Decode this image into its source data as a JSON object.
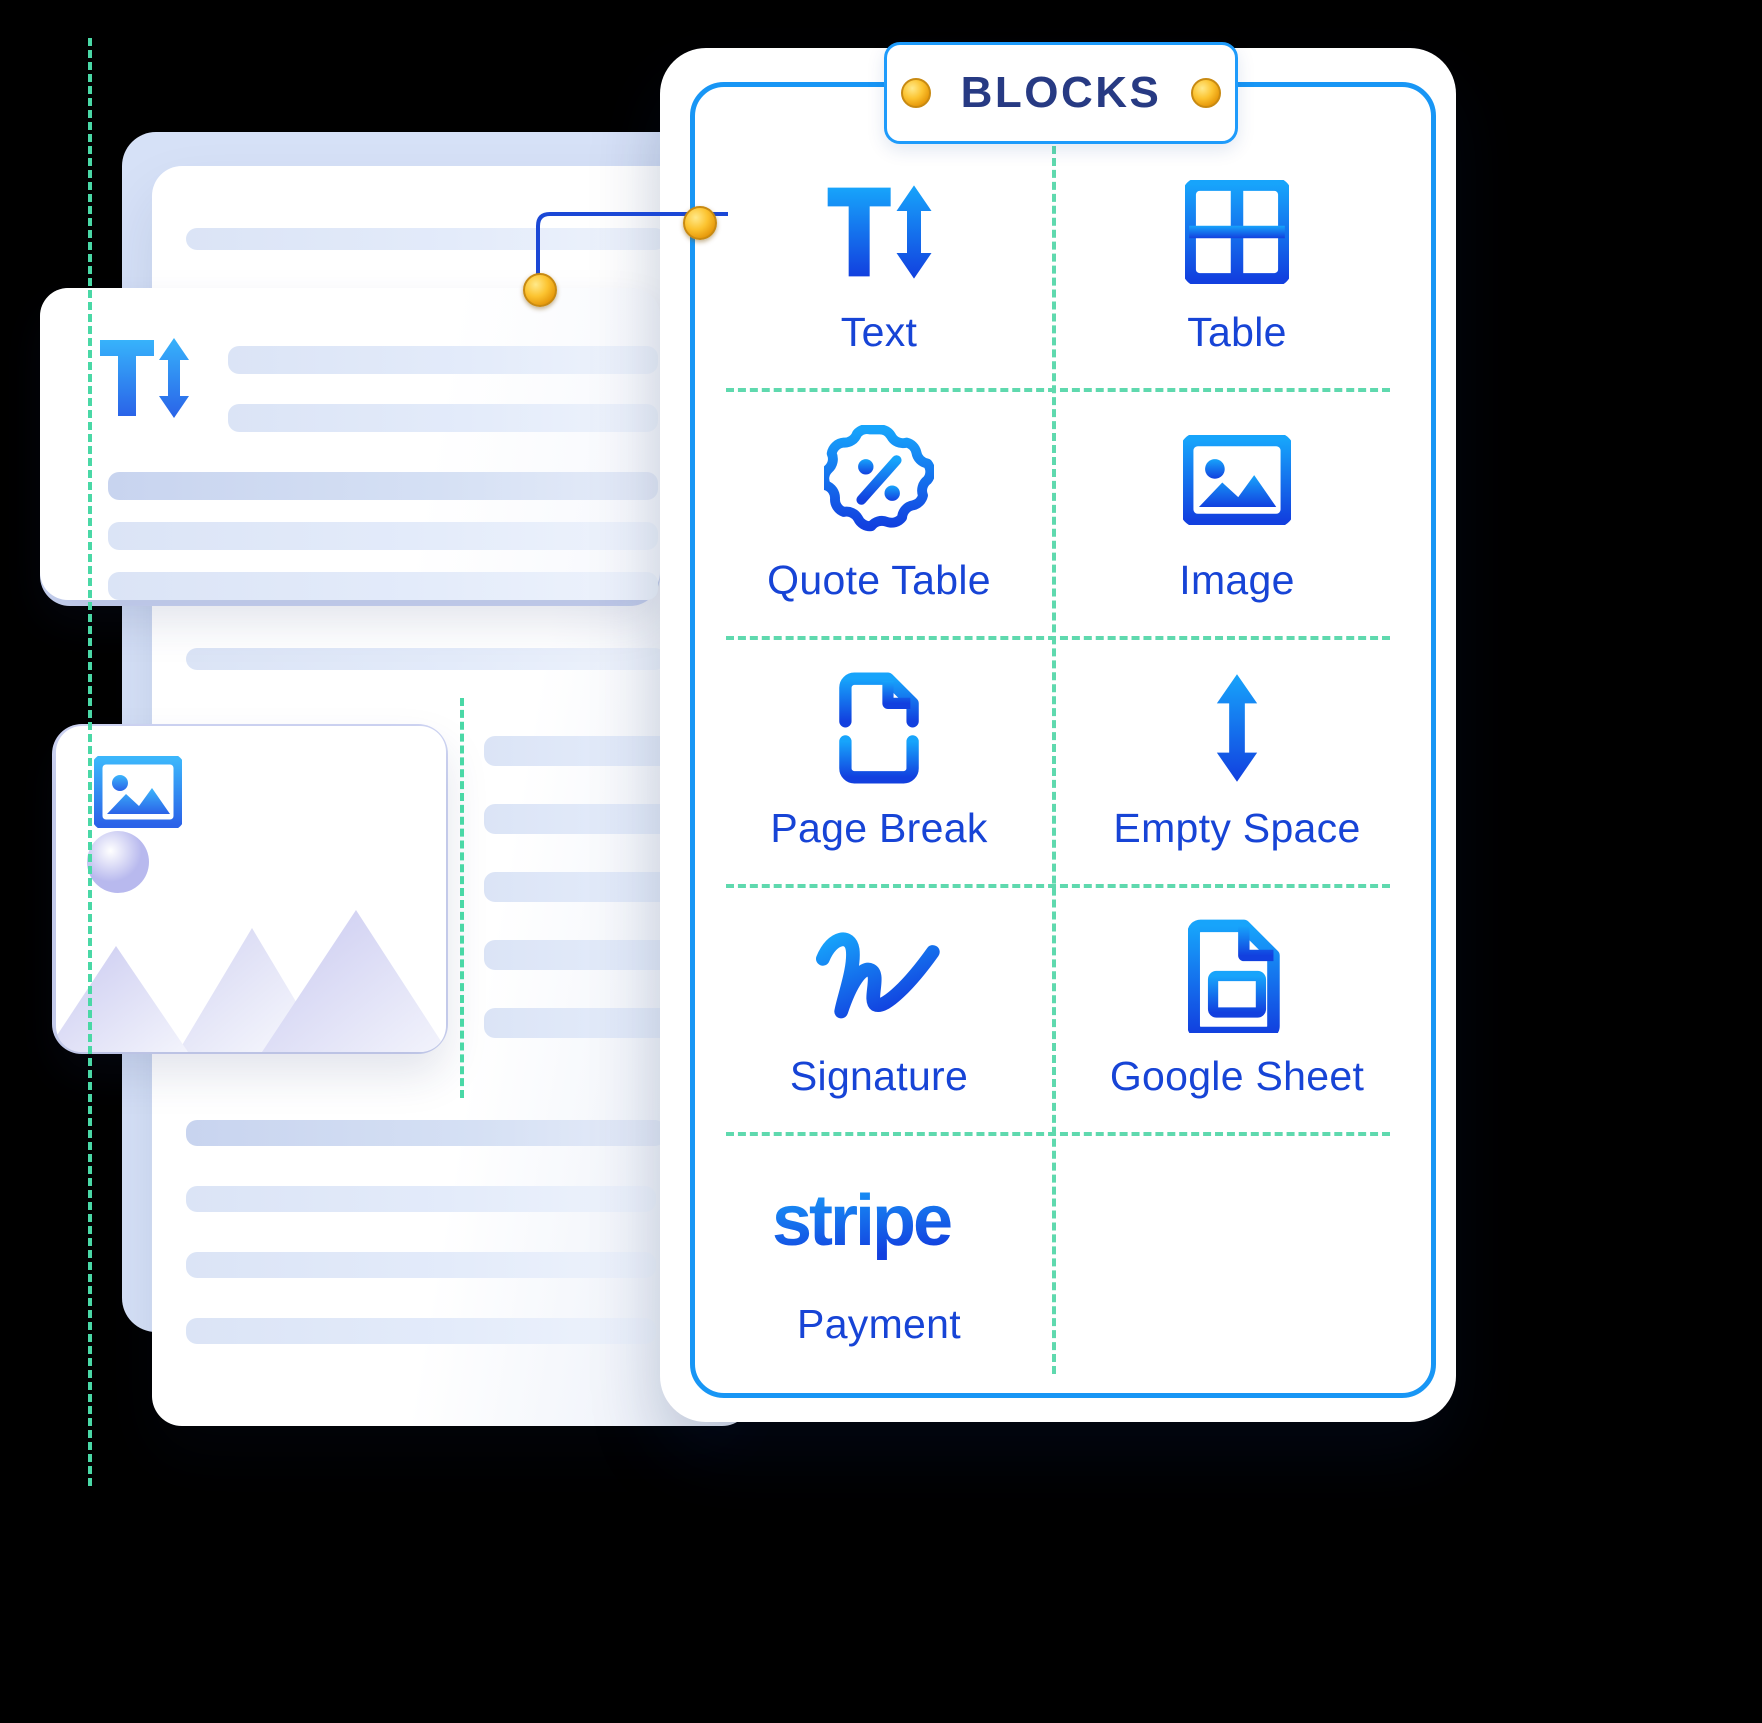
{
  "panel": {
    "badge_title": "BLOCKS",
    "badge_dot_left": "gold-dot-left",
    "badge_dot_right": "gold-dot-right",
    "accent_blue": "#1896f5",
    "label_blue": "#1744d6",
    "title_navy": "#273a83",
    "grid_dash": "#5fd9ae",
    "gold": "#fcc431"
  },
  "blocks": [
    {
      "label": "Text",
      "icon": "text-resize-icon"
    },
    {
      "label": "Table",
      "icon": "table-grid-icon"
    },
    {
      "label": "Quote Table",
      "icon": "discount-badge-icon"
    },
    {
      "label": "Image",
      "icon": "image-placeholder-icon"
    },
    {
      "label": "Page Break",
      "icon": "page-break-icon"
    },
    {
      "label": "Empty Space",
      "icon": "vertical-arrows-icon"
    },
    {
      "label": "Signature",
      "icon": "signature-scribble-icon"
    },
    {
      "label": "Google Sheet",
      "icon": "google-sheet-icon"
    },
    {
      "label": "Payment",
      "icon": "stripe-logo-icon"
    }
  ],
  "stripe": {
    "wordmark": "stripe"
  },
  "document_preview": {
    "text_card_icon": "text-resize-icon",
    "image_card_icon": "image-placeholder-icon"
  }
}
